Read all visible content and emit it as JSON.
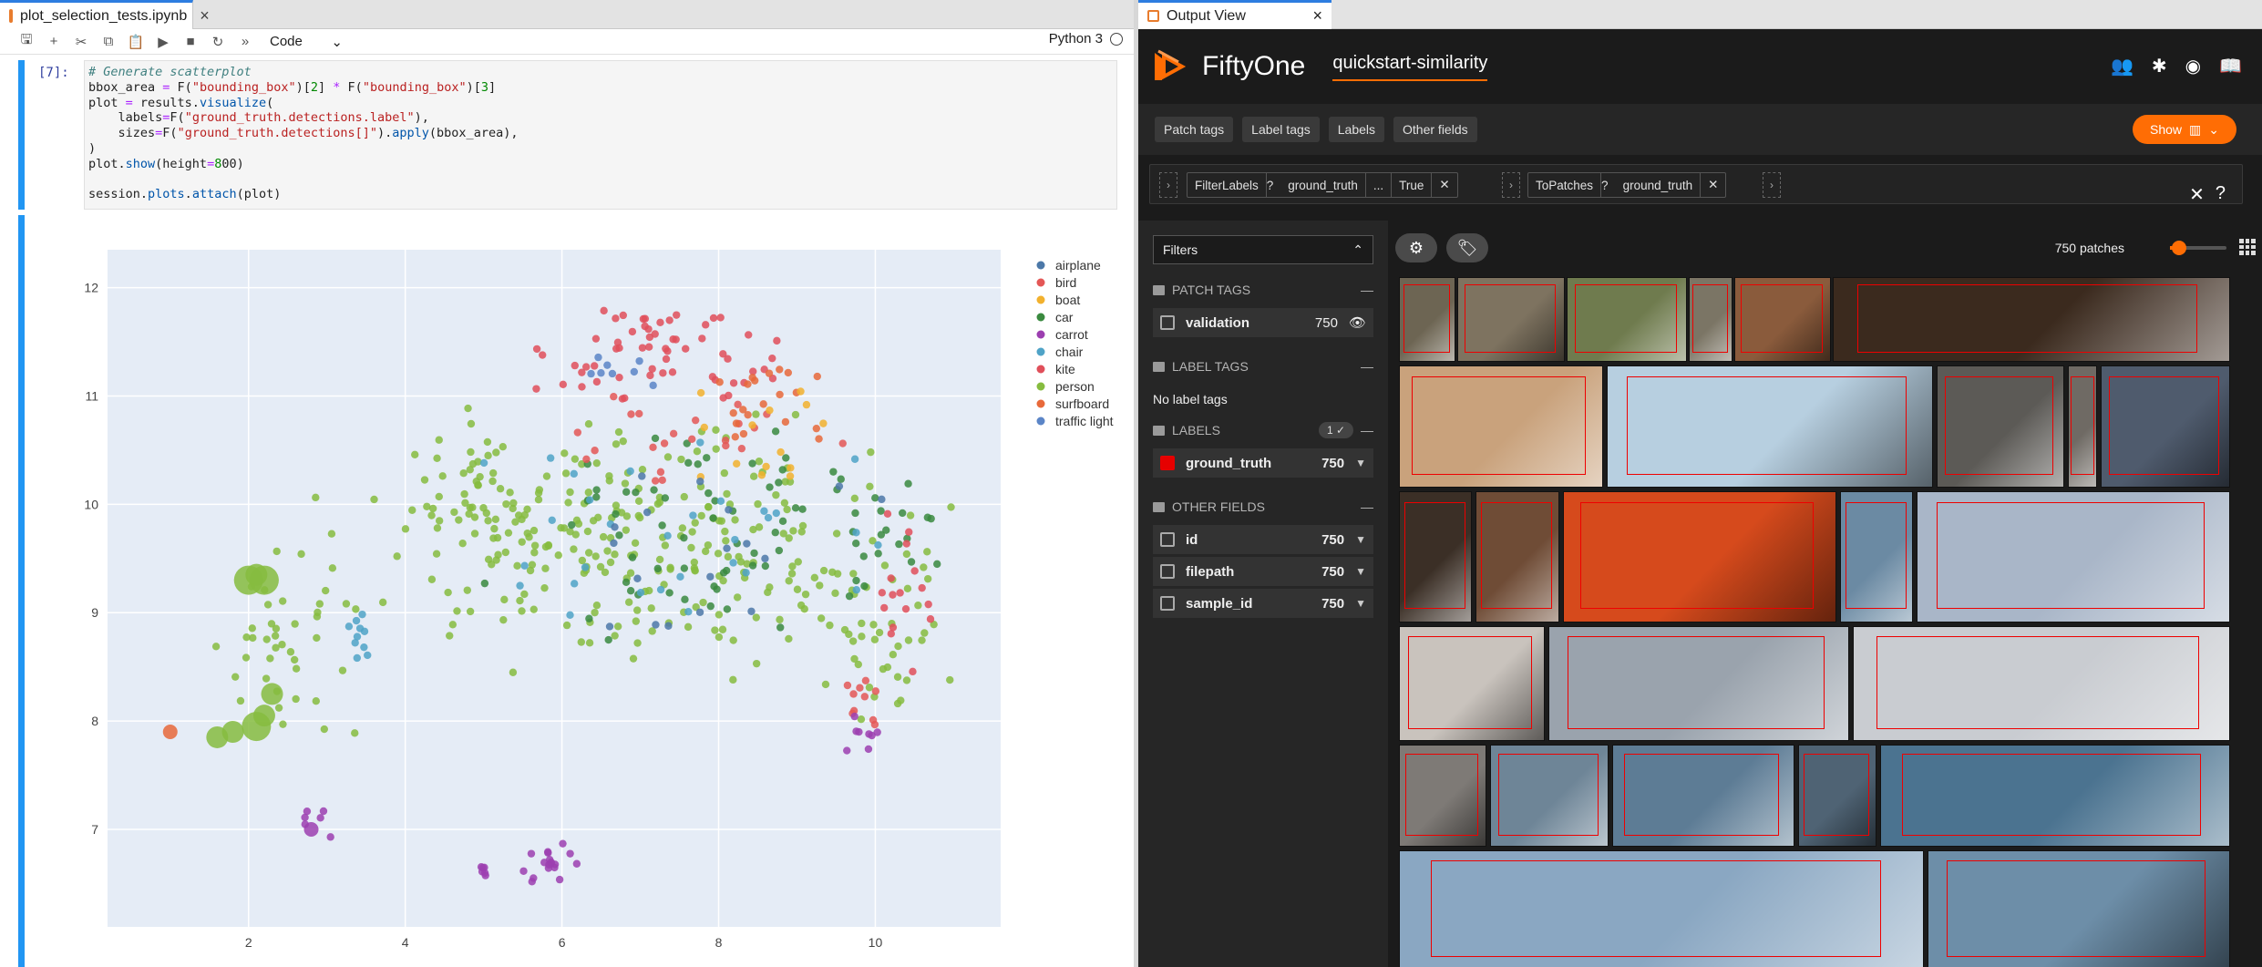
{
  "notebook": {
    "tab_name": "plot_selection_tests.ipynb",
    "celltype": "Code",
    "kernel": "Python 3",
    "prompt": "[7]:",
    "code_lines": [
      "# Generate scatterplot",
      "bbox_area = F(\"bounding_box\")[2] * F(\"bounding_box\")[3]",
      "plot = results.visualize(",
      "    labels=F(\"ground_truth.detections.label\"),",
      "    sizes=F(\"ground_truth.detections[]\").apply(bbox_area),",
      ")",
      "plot.show(height=800)",
      "",
      "session.plots.attach(plot)"
    ]
  },
  "chart_data": {
    "type": "scatter",
    "xlim": [
      0.2,
      11.6
    ],
    "ylim": [
      6.1,
      12.35
    ],
    "xticks": [
      2,
      4,
      6,
      8,
      10
    ],
    "yticks": [
      7,
      8,
      9,
      10,
      11,
      12
    ],
    "grid": true,
    "legend_position": "top-right",
    "colors": {
      "airplane": "#4c78a8",
      "bird": "#e45756",
      "boat": "#f2b12e",
      "car": "#3a8a3f",
      "carrot": "#9c3fb0",
      "chair": "#4fa3c7",
      "kite": "#e04f5a",
      "person": "#86bc3f",
      "surfboard": "#e8693a",
      "traffic light": "#5b85c7"
    },
    "legend": [
      "airplane",
      "bird",
      "boat",
      "car",
      "carrot",
      "chair",
      "kite",
      "person",
      "surfboard",
      "traffic light"
    ],
    "clusters": [
      {
        "label": "person",
        "cx": 7.2,
        "cy": 9.6,
        "rx": 3.3,
        "ry": 1.0,
        "n": 260
      },
      {
        "label": "person",
        "cx": 2.4,
        "cy": 8.7,
        "rx": 0.9,
        "ry": 0.8,
        "n": 40
      },
      {
        "label": "person",
        "cx": 4.8,
        "cy": 10.0,
        "rx": 1.0,
        "ry": 0.6,
        "n": 40
      },
      {
        "label": "person",
        "cx": 10.2,
        "cy": 8.6,
        "rx": 0.6,
        "ry": 0.9,
        "n": 30
      },
      {
        "label": "car",
        "cx": 7.8,
        "cy": 9.8,
        "rx": 2.4,
        "ry": 0.9,
        "n": 60
      },
      {
        "label": "car",
        "cx": 10.1,
        "cy": 9.7,
        "rx": 0.6,
        "ry": 0.5,
        "n": 18
      },
      {
        "label": "kite",
        "cx": 7.3,
        "cy": 11.4,
        "rx": 1.3,
        "ry": 0.5,
        "n": 60
      },
      {
        "label": "kite",
        "cx": 10.4,
        "cy": 9.2,
        "rx": 0.4,
        "ry": 0.8,
        "n": 16
      },
      {
        "label": "bird",
        "cx": 7.8,
        "cy": 10.6,
        "rx": 1.6,
        "ry": 0.6,
        "n": 22
      },
      {
        "label": "bird",
        "cx": 9.9,
        "cy": 8.2,
        "rx": 0.3,
        "ry": 0.3,
        "n": 10
      },
      {
        "label": "surfboard",
        "cx": 8.6,
        "cy": 10.9,
        "rx": 0.9,
        "ry": 0.5,
        "n": 20
      },
      {
        "label": "boat",
        "cx": 8.6,
        "cy": 10.6,
        "rx": 1.2,
        "ry": 0.6,
        "n": 14
      },
      {
        "label": "chair",
        "cx": 7.6,
        "cy": 9.6,
        "rx": 2.6,
        "ry": 1.0,
        "n": 30
      },
      {
        "label": "chair",
        "cx": 3.4,
        "cy": 8.8,
        "rx": 0.4,
        "ry": 0.3,
        "n": 10
      },
      {
        "label": "airplane",
        "cx": 8.2,
        "cy": 9.5,
        "rx": 2.4,
        "ry": 0.9,
        "n": 18
      },
      {
        "label": "traffic light",
        "cx": 6.6,
        "cy": 11.3,
        "rx": 0.6,
        "ry": 0.3,
        "n": 8
      },
      {
        "label": "carrot",
        "cx": 5.8,
        "cy": 6.7,
        "rx": 0.3,
        "ry": 0.2,
        "n": 18
      },
      {
        "label": "carrot",
        "cx": 5.0,
        "cy": 6.62,
        "rx": 0.1,
        "ry": 0.08,
        "n": 6
      },
      {
        "label": "carrot",
        "cx": 2.9,
        "cy": 7.1,
        "rx": 0.3,
        "ry": 0.2,
        "n": 6
      },
      {
        "label": "carrot",
        "cx": 9.9,
        "cy": 7.9,
        "rx": 0.3,
        "ry": 0.2,
        "n": 8
      }
    ],
    "big_points": [
      {
        "label": "person",
        "x": 2.0,
        "y": 9.3,
        "size": 3
      },
      {
        "label": "person",
        "x": 2.2,
        "y": 9.3,
        "size": 3
      },
      {
        "label": "person",
        "x": 2.1,
        "y": 9.35,
        "size": 2
      },
      {
        "label": "person",
        "x": 2.2,
        "y": 8.05,
        "size": 2
      },
      {
        "label": "person",
        "x": 2.1,
        "y": 7.95,
        "size": 3
      },
      {
        "label": "person",
        "x": 1.8,
        "y": 7.9,
        "size": 2
      },
      {
        "label": "person",
        "x": 2.3,
        "y": 8.25,
        "size": 2
      },
      {
        "label": "person",
        "x": 1.6,
        "y": 7.85,
        "size": 2
      },
      {
        "label": "surfboard",
        "x": 1.0,
        "y": 7.9,
        "size": 1
      },
      {
        "label": "carrot",
        "x": 2.8,
        "y": 7.0,
        "size": 1
      }
    ]
  },
  "output_view": {
    "tab_name": "Output View",
    "brand": "FiftyOne",
    "dataset": "quickstart-similarity",
    "nav_buttons": [
      "Patch tags",
      "Label tags",
      "Labels",
      "Other fields"
    ],
    "show_label": "Show",
    "stage1": {
      "name": "FilterLabels",
      "field": "ground_truth",
      "more": "...",
      "value": "True"
    },
    "stage2": {
      "name": "ToPatches",
      "field": "ground_truth"
    },
    "filters_label": "Filters",
    "patch_tags_title": "PATCH TAGS",
    "validation": {
      "name": "validation",
      "count": "750"
    },
    "label_tags_title": "LABEL TAGS",
    "no_label_tags": "No label tags",
    "labels_title": "LABELS",
    "labels_pill": "1 ✓",
    "ground_truth": {
      "name": "ground_truth",
      "count": "750"
    },
    "other_fields_title": "OTHER FIELDS",
    "fields": [
      {
        "name": "id",
        "count": "750"
      },
      {
        "name": "filepath",
        "count": "750"
      },
      {
        "name": "sample_id",
        "count": "750"
      }
    ],
    "patch_count": "750 patches"
  }
}
